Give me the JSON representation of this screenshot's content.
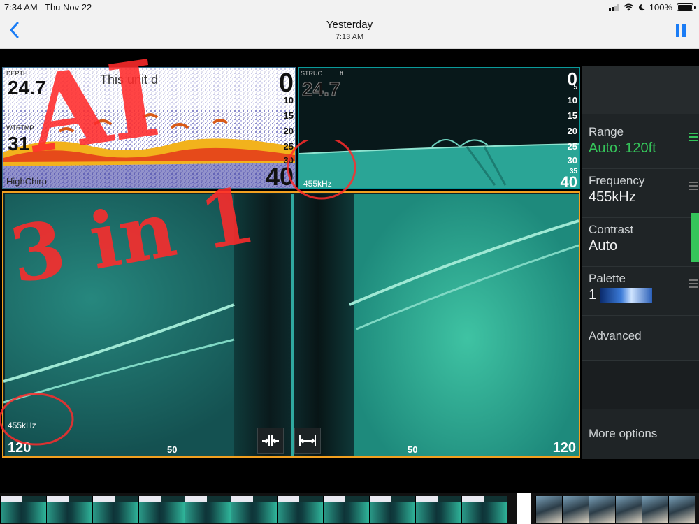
{
  "status_bar": {
    "time": "7:34 AM",
    "date": "Thu Nov 22",
    "battery_percent": "100%"
  },
  "nav": {
    "title": "Yesterday",
    "subtitle": "7:13 AM"
  },
  "sonar": {
    "top_left": {
      "depth_label": "DEPTH",
      "depth_value": "24.7",
      "temp_label": "WTRTMP",
      "temp_value": "31",
      "overlay_text": "This unit d",
      "mode_label": "HighChirp",
      "scale_top": "0",
      "scale_bottom": "40",
      "scale_ticks": [
        "10",
        "15",
        "20",
        "25",
        "30"
      ]
    },
    "top_right": {
      "label": "STRUC",
      "unit": "ft",
      "depth_value": "24.7",
      "frequency": "455kHz",
      "scale_top": "0",
      "scale_bottom": "40",
      "scale_ticks": [
        "5",
        "10",
        "15",
        "20",
        "25",
        "30",
        "35"
      ]
    },
    "side_scan": {
      "frequency": "455kHz",
      "left_range": "120",
      "right_range": "120",
      "left_mid": "50",
      "right_mid": "50"
    }
  },
  "annotations": {
    "line1": "AI",
    "line2": "3 in 1"
  },
  "menu": {
    "range_label": "Range",
    "range_value": "Auto: 120ft",
    "frequency_label": "Frequency",
    "frequency_value": "455kHz",
    "contrast_label": "Contrast",
    "contrast_value": "Auto",
    "palette_label": "Palette",
    "palette_value": "1",
    "advanced_label": "Advanced",
    "more_options_label": "More options"
  },
  "colors": {
    "accent_green": "#35c45a",
    "ios_blue": "#1a7cf5",
    "frame_orange": "#f2a020"
  }
}
